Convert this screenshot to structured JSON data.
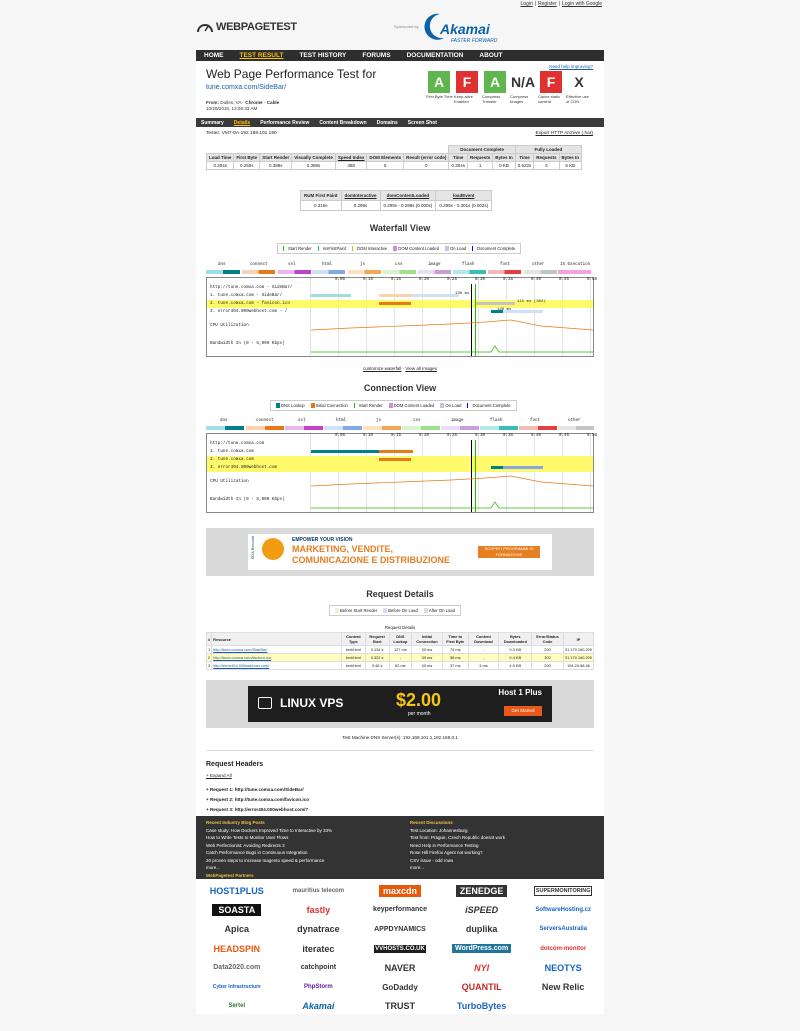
{
  "top_links": [
    "Login",
    "Register",
    "Login with Google"
  ],
  "logo": "WEBPAGETEST",
  "sponsored": "Sponsored by",
  "sponsor": {
    "name": "Akamai",
    "tagline": "FASTER FORWARD"
  },
  "nav": [
    "HOME",
    "TEST RESULT",
    "TEST HISTORY",
    "FORUMS",
    "DOCUMENTATION",
    "ABOUT"
  ],
  "title": "Web Page Performance Test for",
  "url": "tune.comxa.com/SideBar/",
  "from": {
    "label": "From:",
    "loc": "Dulles, VA",
    "browser": "Chrome",
    "conn": "Cable",
    "date": "10/26/2016, 12:06:33 AM"
  },
  "help": "Need help improving?",
  "grades": [
    {
      "g": "A",
      "l": "First Byte Time",
      "c": "A"
    },
    {
      "g": "F",
      "l": "Keep-alive Enabled",
      "c": "F"
    },
    {
      "g": "A",
      "l": "Compress Transfer",
      "c": "A"
    },
    {
      "g": "N/A",
      "l": "Compress Images",
      "c": "N"
    },
    {
      "g": "F",
      "l": "Cache static content",
      "c": "F"
    },
    {
      "g": "X",
      "l": "Effective use of CDN",
      "c": "X"
    }
  ],
  "subnav": [
    "Summary",
    "Details",
    "Performance Review",
    "Content Breakdown",
    "Domains",
    "Screen Shot"
  ],
  "tester": "Tester: VM7-0A-192.168.101.190",
  "export": "Export HTTP Archive (.har)",
  "summary": {
    "groups": [
      "Document Complete",
      "Fully Loaded"
    ],
    "headers": [
      "Load Time",
      "First Byte",
      "Start Render",
      "Visually Complete",
      "Speed Index",
      "DOM Elements",
      "Result (error code)",
      "Time",
      "Requests",
      "Bytes In",
      "Time",
      "Requests",
      "Bytes In"
    ],
    "row": [
      "0.304s",
      "0.250s",
      "0.388s",
      "0.388s",
      "388",
      "5",
      "0",
      "0.304s",
      "1",
      "0 KB",
      "0.522s",
      "3",
      "5 KB"
    ]
  },
  "rum": {
    "headers": [
      "RUM First Paint",
      "domInteractive",
      "domContentLoaded",
      "loadEvent"
    ],
    "row": [
      "0.316s",
      "0.299s",
      "0.299s - 0.299s (0.000s)",
      "0.299s - 0.301s (0.002s)"
    ]
  },
  "waterfall_title": "Waterfall View",
  "wf_legend": [
    "Start Render",
    "msFirstPaint",
    "DOM Interactive",
    "DOM Content Loaded",
    "On Load",
    "Document Complete"
  ],
  "wf_types": [
    "dns",
    "connect",
    "ssl",
    "html",
    "js",
    "css",
    "image",
    "flash",
    "font",
    "other",
    "JS Execution"
  ],
  "wf_rows": [
    "http://tune.comxa.com - SideBar/",
    "1. tune.comxa.com - SideBar/",
    "2. tune.comxa.com - favicon.ico",
    "3. error404.000webhost.com - /"
  ],
  "wf_ticks": [
    "0.05",
    "0.10",
    "0.15",
    "0.20",
    "0.25",
    "0.30",
    "0.35",
    "0.40",
    "0.45",
    "0.50"
  ],
  "wf_labels": [
    "130 ms",
    "115 ms (302)",
    "140 ms"
  ],
  "cpu": "CPU Utilization",
  "bw": "Bandwidth In (0 - 5,000 Kbps)",
  "customize": "customize waterfall",
  "view_images": "View all Images",
  "conn_title": "Connection View",
  "conn_legend": [
    "DNS Lookup",
    "Initial Connection",
    "Start Render",
    "DOM Content Loaded",
    "On Load",
    "Document Complete"
  ],
  "conn_types": [
    "dns",
    "connect",
    "ssl",
    "html",
    "js",
    "css",
    "image",
    "flash",
    "font",
    "other"
  ],
  "conn_rows": [
    "http://tune.comxa.com",
    "1. tune.comxa.com",
    "2. tune.comxa.com",
    "3. error404.000webhost.com"
  ],
  "ad1": {
    "brand": "SDA Bocconi",
    "line1": "EMPOWER YOUR VISION",
    "line2": "MARKETING, VENDITE,",
    "line3": "COMUNICAZIONE E DISTRIBUZIONE",
    "cta": "SCOPRI I PROGRAMMI DI FORMAZIONE"
  },
  "req_title": "Request Details",
  "req_legend": [
    "Before Start Render",
    "Before On Load",
    "After On Load"
  ],
  "req_caption": "Request Details",
  "req_headers": [
    "#",
    "Resource",
    "Content Type",
    "Request Start",
    "DNS Lookup",
    "Initial Connection",
    "Time to First Byte",
    "Content Download",
    "Bytes Downloaded",
    "Error/Status Code",
    "IP"
  ],
  "req_rows": [
    [
      "1",
      "http://tune.comxa.com/SideBar/",
      "text/html",
      "0.134 s",
      "127 ms",
      "30 ms",
      "74 ms",
      "-",
      "0.3 KB",
      "200",
      "31.170.160.209"
    ],
    [
      "2",
      "http://tune.comxa.com/favicon.ico",
      "text/html",
      "0.322 s",
      "-",
      "39 ms",
      "56 ms",
      "-",
      "0.4 KB",
      "302",
      "31.170.160.209"
    ],
    [
      "3",
      "http://error404.000webhost.com/",
      "text/html",
      "0.48 s",
      "82 ms",
      "30 ms",
      "37 ms",
      "3 ms",
      "4.5 KB",
      "200",
      "104.20.88.46"
    ]
  ],
  "ad2": {
    "text": "LINUX VPS",
    "price": "$2.00",
    "per": "per month",
    "brand": "Host 1 Plus",
    "cta": "Get Started"
  },
  "dns_servers": "Test Machine DNS Server(s): 192.168.101.1,192.168.0.1",
  "req_headers_title": "Request Headers",
  "expand": "+ Expand All",
  "requests": [
    "+ Request 1: http://tune.comxa.com/SideBar/",
    "+ Request 2: http://tune.comxa.com/favicon.ico",
    "+ Request 3: http://error404.000webhost.com/?"
  ],
  "blog_title": "Recent Industry Blog Posts",
  "blog": [
    "Case study: How Dockers Improved Time to Interactive by 33%",
    "How to Write Tests to Monitor User Flows",
    "Web Perfectionist: Avoiding Redirects 3",
    "Catch Performance Bugs in Continuous Integration",
    "20 proven steps to increase magento speed & performance",
    "more..."
  ],
  "disc_title": "Recent Discussions",
  "disc": [
    "Test Location: Johannesburg",
    "Test from: Prague, Czech Republic doesnt work",
    "Need Help in Performance Testing",
    "Rose Hill Firefox Agent not working?",
    "CSV issue - odd rows",
    "more..."
  ],
  "partners_title": "WebPagetest Partners",
  "partners": [
    "HOST1PLUS",
    "mauritius telecom",
    "maxcdn",
    "ZENEDGE",
    "SUPERMONITORING",
    "SOASTA",
    "fastly",
    "keyperformance",
    "iSPEED",
    "SoftwareHosting.cz",
    "Apica",
    "dynatrace",
    "APPDYNAMICS",
    "duplika",
    "ServersAustralia",
    "HEADSPIN",
    "iteratec",
    "VVHOSTS.CO.UK",
    "WordPress.com",
    "dotcom-monitor",
    "Data2020.com",
    "catchpoint",
    "NAVER",
    "NYI",
    "NEOTYS",
    "Cyber Infrastructure",
    "PhpStorm",
    "GoDaddy",
    "QUANTIL",
    "New Relic",
    "Sertel",
    "Akamai",
    "TRUST",
    "TurboBytes"
  ],
  "colors": {
    "dns": "#00818a",
    "connect": "#e87918",
    "ssl": "#c141cd",
    "html": "#82a8e6",
    "js": "#f1a754",
    "css": "#9de18c",
    "image": "#c89fdb",
    "flash": "#37bfb7",
    "font": "#e24040",
    "other": "#c4c4c4",
    "grade_a": "#5fb54e",
    "grade_f": "#e03131",
    "accent": "#f9c00f"
  }
}
